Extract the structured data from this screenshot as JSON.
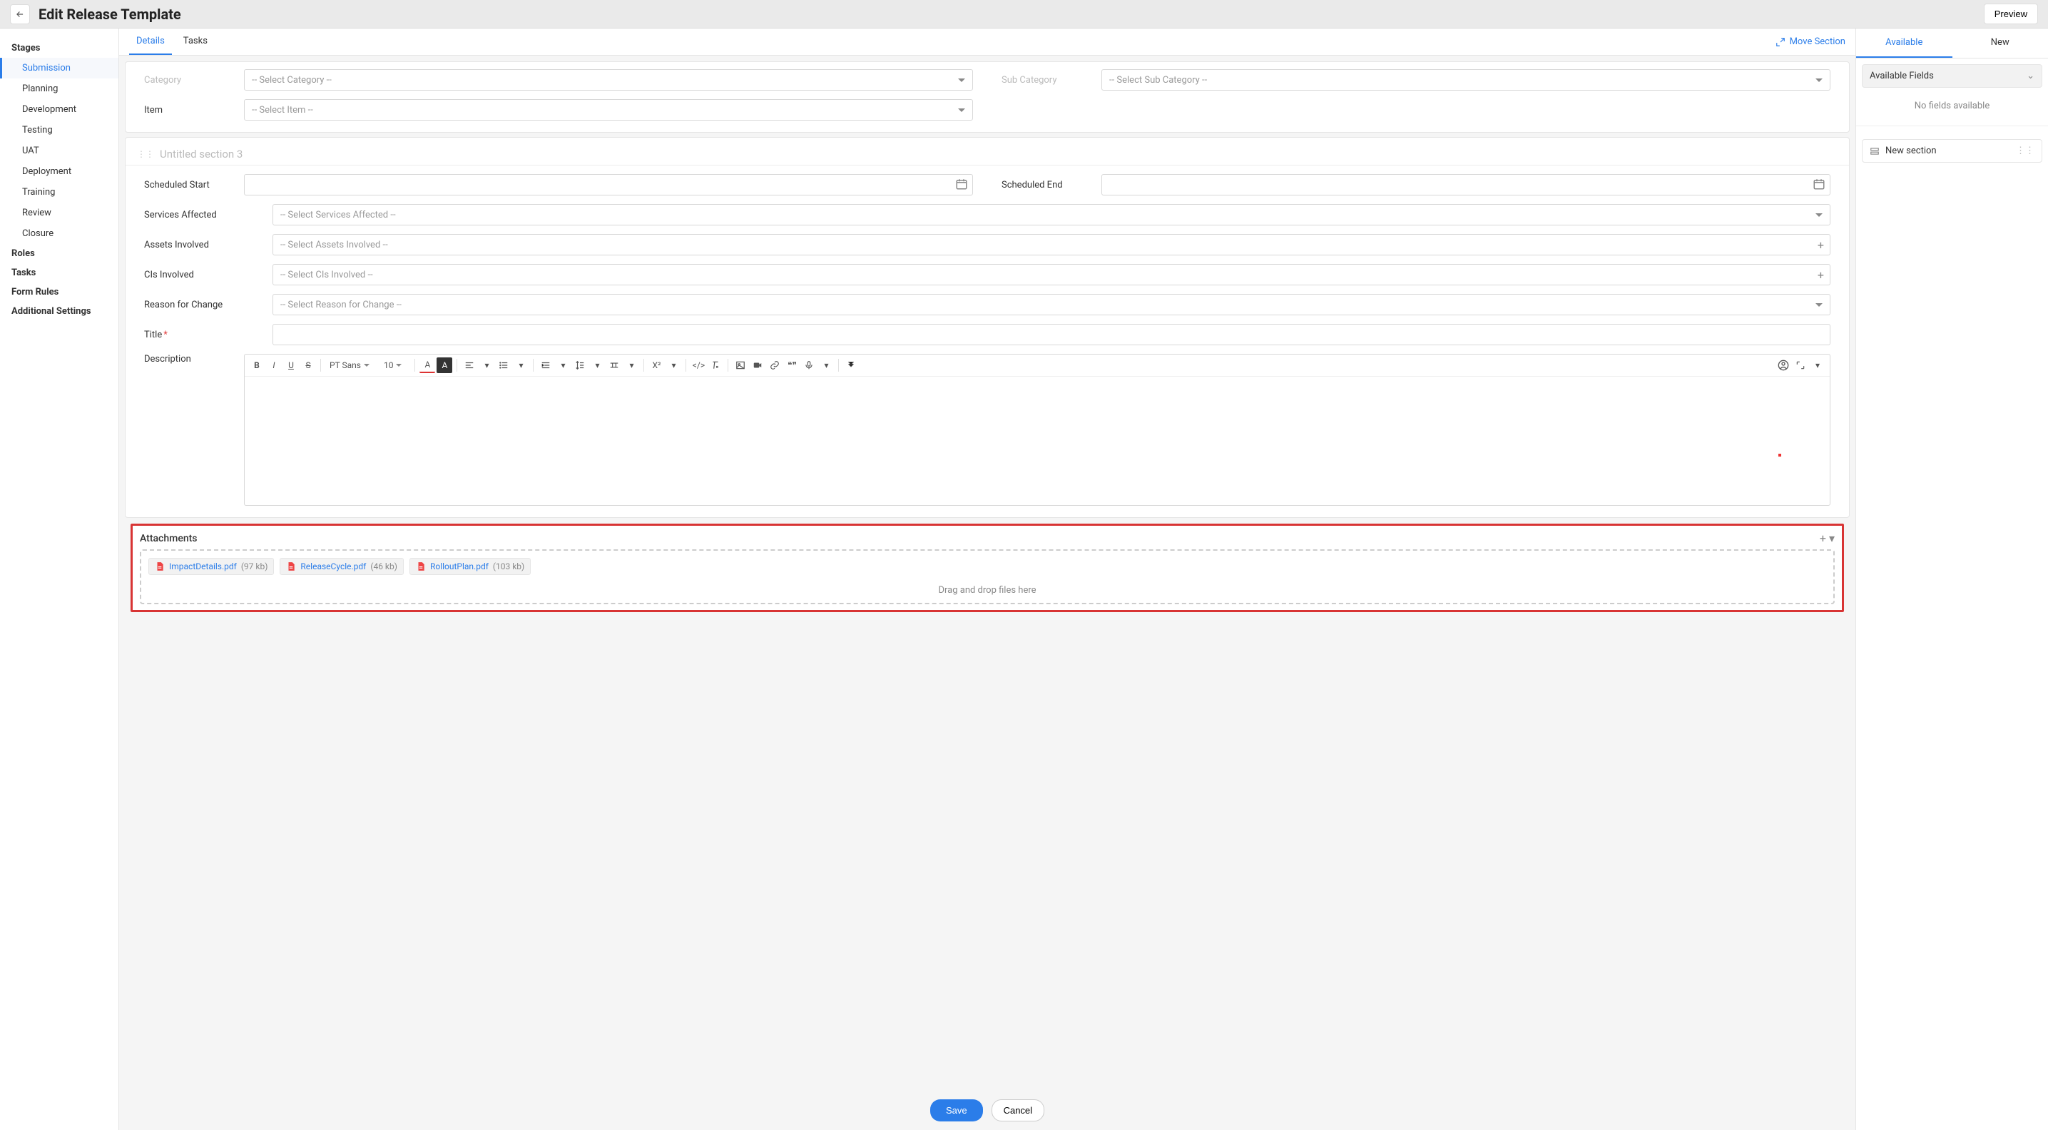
{
  "header": {
    "title": "Edit Release Template",
    "preview": "Preview"
  },
  "sidebar": {
    "sections": [
      {
        "label": "Stages",
        "items": [
          "Submission",
          "Planning",
          "Development",
          "Testing",
          "UAT",
          "Deployment",
          "Training",
          "Review",
          "Closure"
        ]
      },
      {
        "label": "Roles",
        "items": []
      },
      {
        "label": "Tasks",
        "items": []
      },
      {
        "label": "Form Rules",
        "items": []
      },
      {
        "label": "Additional Settings",
        "items": []
      }
    ],
    "active_stage": "Submission"
  },
  "tabs": {
    "items": [
      "Details",
      "Tasks"
    ],
    "active": "Details",
    "move_section": "Move Section"
  },
  "form": {
    "category": {
      "label": "Category",
      "placeholder": "-- Select Category --"
    },
    "subcategory": {
      "label": "Sub Category",
      "placeholder": "-- Select Sub Category --"
    },
    "item": {
      "label": "Item",
      "placeholder": "-- Select Item --"
    },
    "section3_title": "Untitled section 3",
    "scheduled_start": {
      "label": "Scheduled Start"
    },
    "scheduled_end": {
      "label": "Scheduled End"
    },
    "services_affected": {
      "label": "Services Affected",
      "placeholder": "-- Select Services Affected --"
    },
    "assets_involved": {
      "label": "Assets Involved",
      "placeholder": "-- Select Assets Involved --"
    },
    "cis_involved": {
      "label": "CIs Involved",
      "placeholder": "-- Select CIs Involved --"
    },
    "reason_for_change": {
      "label": "Reason for Change",
      "placeholder": "-- Select Reason for Change --"
    },
    "title": {
      "label": "Title"
    },
    "description": {
      "label": "Description"
    },
    "editor": {
      "font": "PT Sans",
      "size": "10"
    }
  },
  "attachments": {
    "title": "Attachments",
    "drop_text": "Drag and drop files here",
    "files": [
      {
        "name": "ImpactDetails.pdf",
        "size": "(97 kb)"
      },
      {
        "name": "ReleaseCycle.pdf",
        "size": "(46 kb)"
      },
      {
        "name": "RolloutPlan.pdf",
        "size": "(103 kb)"
      }
    ]
  },
  "footer": {
    "save": "Save",
    "cancel": "Cancel"
  },
  "right": {
    "tabs": [
      "Available",
      "New"
    ],
    "active": "Available",
    "fields_head": "Available Fields",
    "fields_empty": "No fields available",
    "new_section": "New section"
  }
}
